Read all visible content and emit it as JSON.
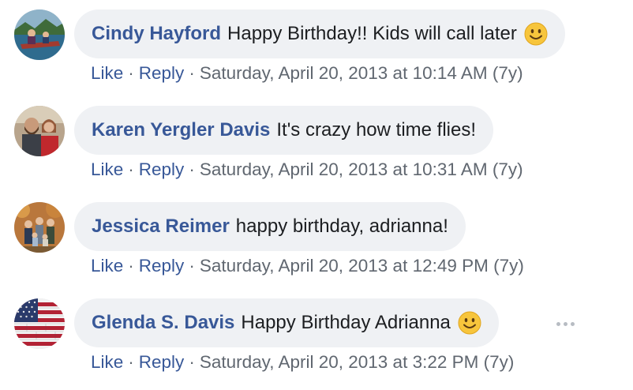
{
  "comments": [
    {
      "author": "Cindy Hayford",
      "text": "Happy Birthday!! Kids will call later",
      "emoji": "smiling-face",
      "like_label": "Like",
      "reply_label": "Reply",
      "timestamp": "Saturday, April 20, 2013 at 10:14 AM (7y)"
    },
    {
      "author": "Karen Yergler Davis",
      "text": "It's crazy how time flies!",
      "emoji": "",
      "like_label": "Like",
      "reply_label": "Reply",
      "timestamp": "Saturday, April 20, 2013 at 10:31 AM (7y)"
    },
    {
      "author": "Jessica Reimer",
      "text": "happy birthday, adrianna!",
      "emoji": "",
      "like_label": "Like",
      "reply_label": "Reply",
      "timestamp": "Saturday, April 20, 2013 at 12:49 PM (7y)"
    },
    {
      "author": "Glenda S. Davis",
      "text": "Happy Birthday Adrianna",
      "emoji": "smiling-face",
      "like_label": "Like",
      "reply_label": "Reply",
      "timestamp": "Saturday, April 20, 2013 at 3:22 PM (7y)"
    }
  ],
  "separator": "·",
  "more_options_icon": "ellipsis-icon",
  "colors": {
    "author_link": "#385898",
    "bubble_background": "#eff1f4",
    "meta_text": "#606770",
    "body_text": "#1c1e21"
  }
}
